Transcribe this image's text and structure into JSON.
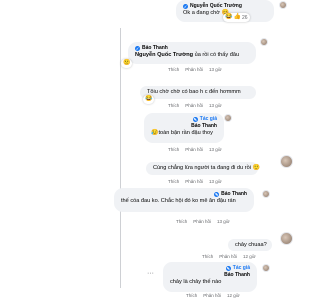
{
  "comments": [
    {
      "author": "Nguyễn Quốc Trường",
      "tag": "",
      "text": "Ok a đang chờ",
      "reacts": "26",
      "time": "",
      "actions": []
    },
    {
      "author": "Bảo Thanh",
      "tag": "",
      "mention": "Nguyễn Quốc Trường",
      "text": " ủa rồi có thấy đâu",
      "reacts": "",
      "time": "13 giờ",
      "actions": [
        "Thích",
        "Phản hồi"
      ]
    },
    {
      "author": "",
      "tag": "",
      "text": "Tôiu chờ chờ có bao h c đến hơmmm",
      "reacts": "",
      "time": "13 giờ",
      "actions": [
        "Thích",
        "Phản hồi"
      ]
    },
    {
      "author": "Bảo Thanh",
      "tag": "Tác giả",
      "text": "toàn bận rần đậu thoy",
      "reacts": "",
      "time": "13 giờ",
      "actions": [
        "Thích",
        "Phản hồi"
      ]
    },
    {
      "author": "",
      "tag": "",
      "text": "Cùng chẳng lừa người ta đang đi du rồi",
      "reacts": "",
      "time": "13 giờ",
      "actions": [
        "Thích",
        "Phản hồi"
      ]
    },
    {
      "author": "Bảo Thanh",
      "tag": "",
      "text": "thế cóa đau ko. Chắc hội đó ko mê ăn đậu rán",
      "reacts": "",
      "time": "13 giờ",
      "actions": [
        "Thích",
        "Phản hồi"
      ]
    },
    {
      "author": "",
      "tag": "",
      "text": "chảy chuaa?",
      "reacts": "",
      "time": "12 giờ",
      "actions": [
        "Thích",
        "Phản hồi"
      ]
    },
    {
      "author": "Bảo Thanh",
      "tag": "Tác giả",
      "text": "chảy là chảy thế nào",
      "reacts": "",
      "time": "12 giờ",
      "actions": [
        "Thích",
        "Phản hồi"
      ]
    }
  ],
  "icons": {
    "check": "verified-badge-icon",
    "like": "like-reaction-icon",
    "love": "love-reaction-icon",
    "haha": "haha-reaction-icon",
    "sad": "sad-reaction-icon"
  }
}
